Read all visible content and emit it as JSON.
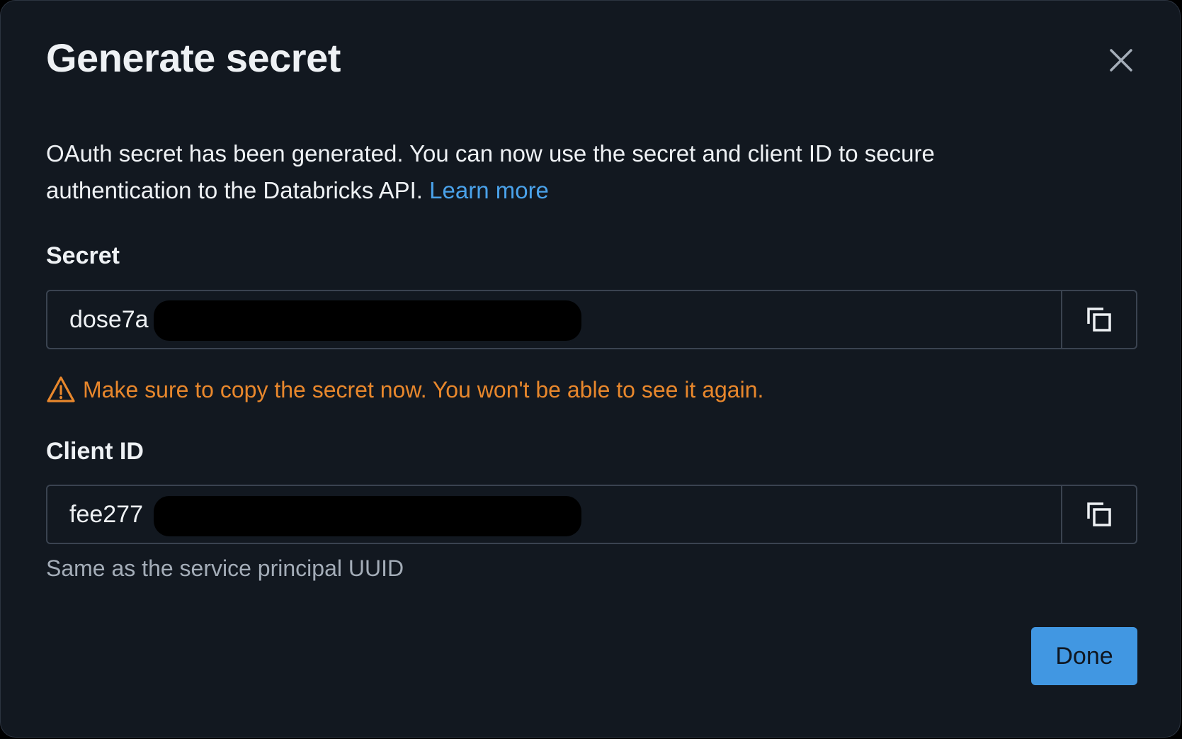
{
  "dialog": {
    "title": "Generate secret",
    "close_icon": "close-icon",
    "description": "OAuth secret has been generated. You can now use the secret and client ID to secure authentication to the Databricks API.",
    "learn_more_label": "Learn more"
  },
  "secret": {
    "label": "Secret",
    "value": "dose7a",
    "copy_icon": "copy-icon"
  },
  "warning": {
    "icon": "warning-icon",
    "text": "Make sure to copy the secret now. You won't be able to see it again."
  },
  "client_id": {
    "label": "Client ID",
    "value": "fee277",
    "copy_icon": "copy-icon",
    "hint": "Same as the service principal UUID"
  },
  "footer": {
    "done_label": "Done"
  },
  "colors": {
    "background": "#121820",
    "border": "#3a4350",
    "text": "#eef1f4",
    "link": "#4aa2ea",
    "warning": "#e8872c",
    "hint": "#a4adb8",
    "primary_button": "#4197e2"
  }
}
